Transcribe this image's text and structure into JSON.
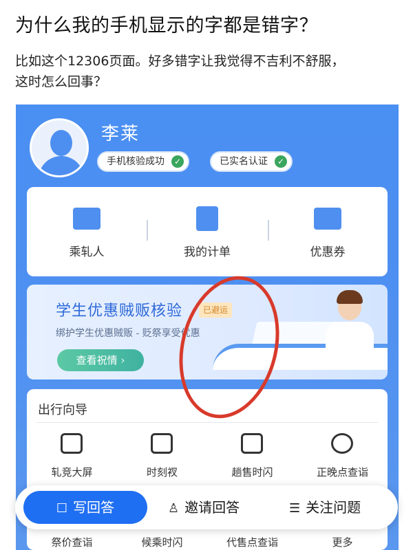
{
  "question": {
    "title": "为什么我的手机显示的字都是错字？",
    "body_line1": "比如这个12306页面。好多错字让我觉得不吉利不舒服，",
    "body_line2": "这时怎么回事？"
  },
  "screenshot": {
    "user_name": "李莱",
    "badges": [
      {
        "label": "手机核验成功"
      },
      {
        "label": "已实名认证"
      }
    ],
    "menu": [
      {
        "label": "乘轧人",
        "icon": "id-card-icon"
      },
      {
        "label": "我的计单",
        "icon": "document-icon"
      },
      {
        "label": "优惠券",
        "icon": "coupon-icon"
      }
    ],
    "banner": {
      "title": "学生优惠贼贩核验",
      "tag": "已避运",
      "subtitle": "绑护学生优惠贼贩 - 贬祭享受优惠",
      "button": "查看祝情 ›"
    },
    "guide": {
      "title": "出行向导",
      "items": [
        {
          "label": "轧竞大屏",
          "icon": "screen-icon"
        },
        {
          "label": "时刻衩",
          "icon": "schedule-icon"
        },
        {
          "label": "趟售时闪",
          "icon": "sale-time-icon"
        },
        {
          "label": "正晚点查诣",
          "icon": "clock-icon"
        }
      ],
      "row2": [
        "祭价查诣",
        "候乘时闪",
        "代售点查诣",
        "更多"
      ]
    }
  },
  "actions": {
    "answer": "写回答",
    "invite": "邀请回答",
    "follow": "关注问题"
  },
  "colors": {
    "app_blue": "#4d8ff1",
    "annotation_red": "#d83a2b",
    "primary_button": "#1f6ff2"
  }
}
